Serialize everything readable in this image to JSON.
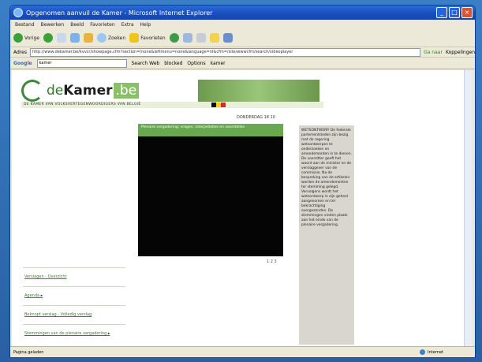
{
  "window": {
    "title": "Opgenomen aanvuil de Kamer - Microsoft Internet Explorer"
  },
  "menu": [
    "Bestand",
    "Bewerken",
    "Beeld",
    "Favorieten",
    "Extra",
    "Help"
  ],
  "toolbar": {
    "back_label": "Vorige",
    "search_label": "Zoeken",
    "favorites_label": "Favorieten"
  },
  "address": {
    "label": "Adres",
    "url": "http://www.dekamer.be/kvvcr/showpage.cfm?section=/none&leftmenu=none&language=nl&cfm=/site/wwwcfm/search/videoplayer",
    "go_label": "Ga naar",
    "links_label": "Koppelingen"
  },
  "google": {
    "brand": "Google",
    "query": "kamer",
    "search_web": "Search Web",
    "blocked": "blocked",
    "options": "Options",
    "term": "kamer"
  },
  "site": {
    "logo_de": "de",
    "logo_kamer": "Kamer",
    "logo_be": ".be",
    "tagline": "DE KAMER VAN VOLKSVERTEGENWOORDIGERS VAN BELGIË",
    "date": "DONDERDAG 18 10",
    "video_title": "Plenaire vergadering: vragen, interpellaties en voorstellen",
    "video_pager": "1 2 3",
    "transcript": "WETSONTWERP. De federale parlementsleden zijn bezig met de regering wetsontwerpen te onderzoeken en amendementen in te dienen. De voorzitter geeft het woord aan de minister en de verslaggever van de commissie. Na de bespreking van de artikelen worden de amendementen ter stemming gelegd. Vervolgens wordt het wetsontwerp in zijn geheel aangenomen en ter bekrachtiging overgezonden. De stemmingen vinden plaats aan het einde van de plenaire vergadering.",
    "left_links": [
      {
        "label": "Verslagen - Overzicht",
        "arrow": ""
      },
      {
        "label": "Agenda",
        "arrow": "▸"
      },
      {
        "label": "Beknopt verslag - Volledig verslag",
        "arrow": ""
      },
      {
        "label": "Stemmingen van de plenaire vergadering",
        "arrow": "▸"
      }
    ]
  },
  "status": {
    "text": "Pagina geladen",
    "zone": "Internet"
  },
  "colors": {
    "accent_green": "#6aa84f",
    "xp_blue": "#1a4fbf"
  }
}
